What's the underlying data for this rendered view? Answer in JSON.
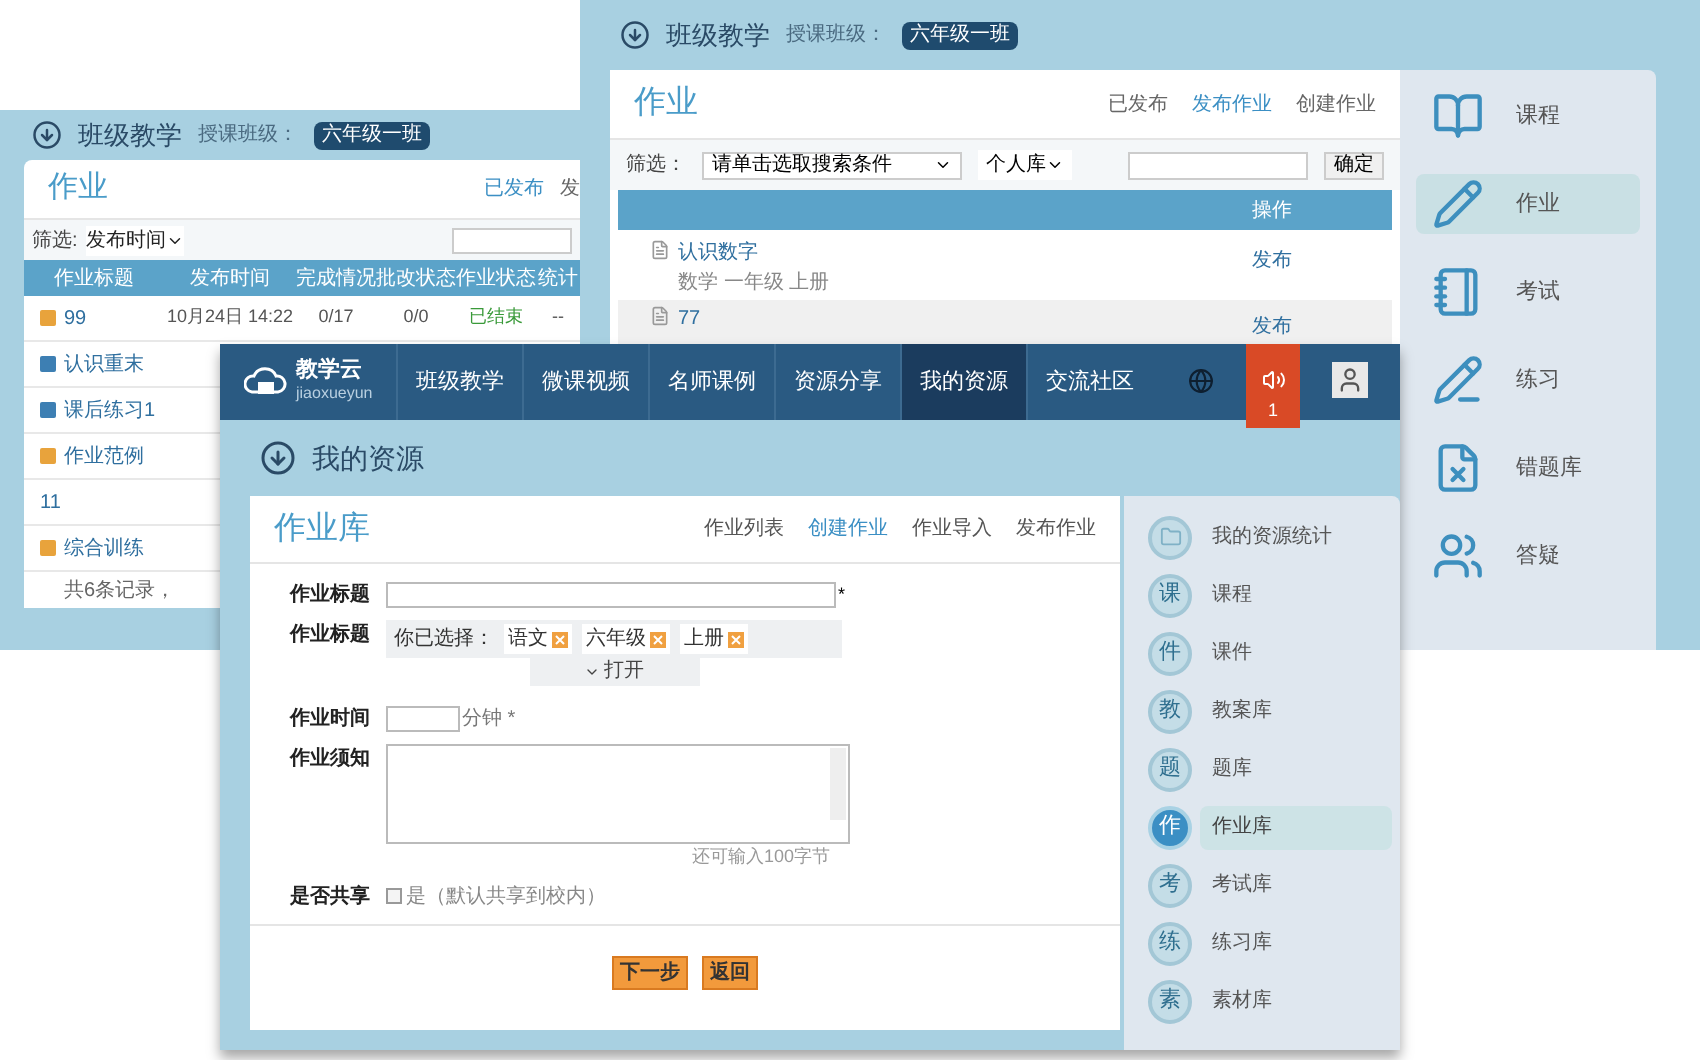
{
  "back_left": {
    "section_title": "班级教学",
    "class_label": "授课班级：",
    "class_name": "六年级一班",
    "card_title": "作业",
    "tabs": [
      {
        "label": "已发布",
        "selected": true
      },
      {
        "label": "发",
        "selected": false
      }
    ],
    "filter_label": "筛选:",
    "filter_select": "发布时间",
    "columns": [
      "作业标题",
      "发布时间",
      "完成情况",
      "批改状态",
      "作业状态",
      "统计"
    ],
    "rows": [
      {
        "title": "99",
        "color": "#e8a33c",
        "cells": [
          "10月24日 14:22",
          "0/17",
          "0/0",
          "已结束",
          "--"
        ]
      },
      {
        "title": "认识重末",
        "color": "#3d7fb3"
      },
      {
        "title": "课后练习1",
        "color": "#3d7fb3"
      },
      {
        "title": "作业范例",
        "color": "#e8a33c"
      },
      {
        "title": "11"
      },
      {
        "title": "综合训练",
        "color": "#e8a33c"
      }
    ],
    "footer": "共6条记录，"
  },
  "back_right": {
    "section_title": "班级教学",
    "class_label": "授课班级：",
    "class_name": "六年级一班",
    "card_title": "作业",
    "tabs": [
      {
        "label": "已发布",
        "selected": false
      },
      {
        "label": "发布作业",
        "selected": true
      },
      {
        "label": "创建作业",
        "selected": false
      }
    ],
    "filter_label": "筛选：",
    "filter_select": "请单击选取搜索条件",
    "library_select": "个人库",
    "confirm_button": "确定",
    "action_column": "操作",
    "rows": [
      {
        "title": "认识数字",
        "subtitle": "数学 一年级 上册",
        "action": "发布"
      },
      {
        "title": "77",
        "action": "发布"
      }
    ],
    "sidebar": [
      {
        "kind": "course",
        "label": "课程",
        "selected": false
      },
      {
        "kind": "homework",
        "label": "作业",
        "selected": true
      },
      {
        "kind": "exam",
        "label": "考试",
        "selected": false
      },
      {
        "kind": "practice",
        "label": "练习",
        "selected": false
      },
      {
        "kind": "mistakes",
        "label": "错题库",
        "selected": false
      },
      {
        "kind": "qa",
        "label": "答疑",
        "selected": false
      }
    ]
  },
  "front": {
    "logo": {
      "name": "教学云",
      "pinyin": "jiaoxueyun"
    },
    "nav": [
      {
        "label": "班级教学",
        "selected": false
      },
      {
        "label": "微课视频",
        "selected": false
      },
      {
        "label": "名师课例",
        "selected": false
      },
      {
        "label": "资源分享",
        "selected": false
      },
      {
        "label": "我的资源",
        "selected": true
      },
      {
        "label": "交流社区",
        "selected": false
      }
    ],
    "notification_count": "1",
    "section_title": "我的资源",
    "card_title": "作业库",
    "tabs": [
      {
        "label": "作业列表",
        "selected": false
      },
      {
        "label": "创建作业",
        "selected": true
      },
      {
        "label": "作业导入",
        "selected": false
      },
      {
        "label": "发布作业",
        "selected": false
      }
    ],
    "form": {
      "title_label": "作业标题",
      "title_required": "*",
      "tags_label": "作业标题",
      "selected_prefix": "你已选择：",
      "tags": [
        "语文",
        "六年级",
        "上册"
      ],
      "expand_button": "打开",
      "time_label": "作业时间",
      "time_unit": "分钟 *",
      "notes_label": "作业须知",
      "notes_hint": "还可输入100字节",
      "share_label": "是否共享",
      "share_option": "是（默认共享到校内）",
      "share_checked": false
    },
    "buttons": [
      "下一步",
      "返回"
    ],
    "sidebar": [
      {
        "label": "我的资源统计",
        "selected": false
      },
      {
        "glyph": "课",
        "label": "课程",
        "selected": false
      },
      {
        "glyph": "件",
        "label": "课件",
        "selected": false
      },
      {
        "glyph": "教",
        "label": "教案库",
        "selected": false
      },
      {
        "glyph": "题",
        "label": "题库",
        "selected": false
      },
      {
        "glyph": "作",
        "label": "作业库",
        "selected": true
      },
      {
        "glyph": "考",
        "label": "考试库",
        "selected": false
      },
      {
        "glyph": "练",
        "label": "练习库",
        "selected": false
      },
      {
        "glyph": "素",
        "label": "素材库",
        "selected": false
      }
    ]
  }
}
